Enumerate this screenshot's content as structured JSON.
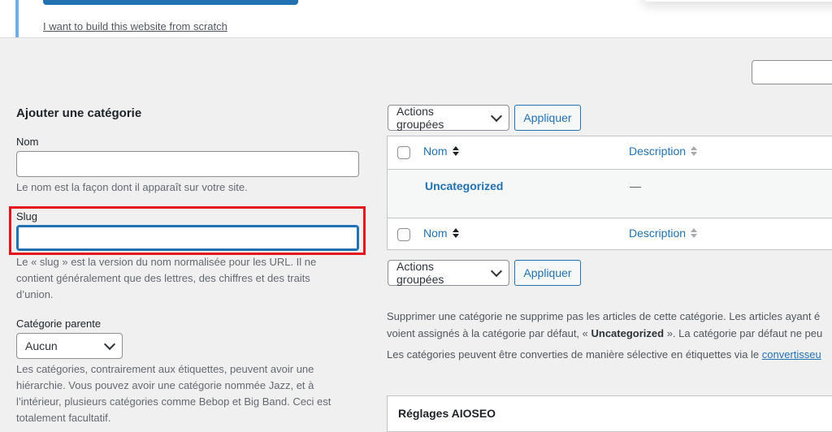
{
  "notice": {
    "link": "I want to build this website from scratch"
  },
  "form": {
    "title": "Ajouter une catégorie",
    "name_label": "Nom",
    "name_value": "",
    "name_help": "Le nom est la façon dont il apparaît sur votre site.",
    "slug_label": "Slug",
    "slug_value": "",
    "slug_help": [
      "Le « slug » est la version du nom normalisée pour les URL. Il ne",
      "contient généralement que des lettres, des chiffres et des traits",
      "d’union."
    ],
    "parent_label": "Catégorie parente",
    "parent_value": "Aucun",
    "parent_help": [
      "Les catégories, contrairement aux étiquettes, peuvent avoir une",
      "hiérarchie. Vous pouvez avoir une catégorie nommée Jazz, et à",
      "l’intérieur, plusieurs catégories comme Bebop et Big Band. Ceci est",
      "totalement facultatif."
    ]
  },
  "bulk": {
    "select_label": "Actions groupées",
    "apply_label": "Appliquer"
  },
  "table": {
    "columns": [
      "Nom",
      "Description"
    ],
    "rows": [
      {
        "name": "Uncategorized",
        "description": "—"
      }
    ]
  },
  "info": {
    "line1": "Supprimer une catégorie ne supprime pas les articles de cette catégorie. Les articles ayant é",
    "line2_pre": "voient assignés à la catégorie par défaut, « ",
    "line2_bold": "Uncategorized",
    "line2_post": " ». La catégorie par défaut ne peu",
    "line3_pre": "Les catégories peuvent être converties de manière sélective en étiquettes via le ",
    "line3_link": "convertisseu"
  },
  "panel": {
    "title": "Réglages AIOSEO"
  },
  "colors": {
    "accent": "#2271b1",
    "highlight": "#e3141c",
    "background": "#f0f0f1"
  }
}
